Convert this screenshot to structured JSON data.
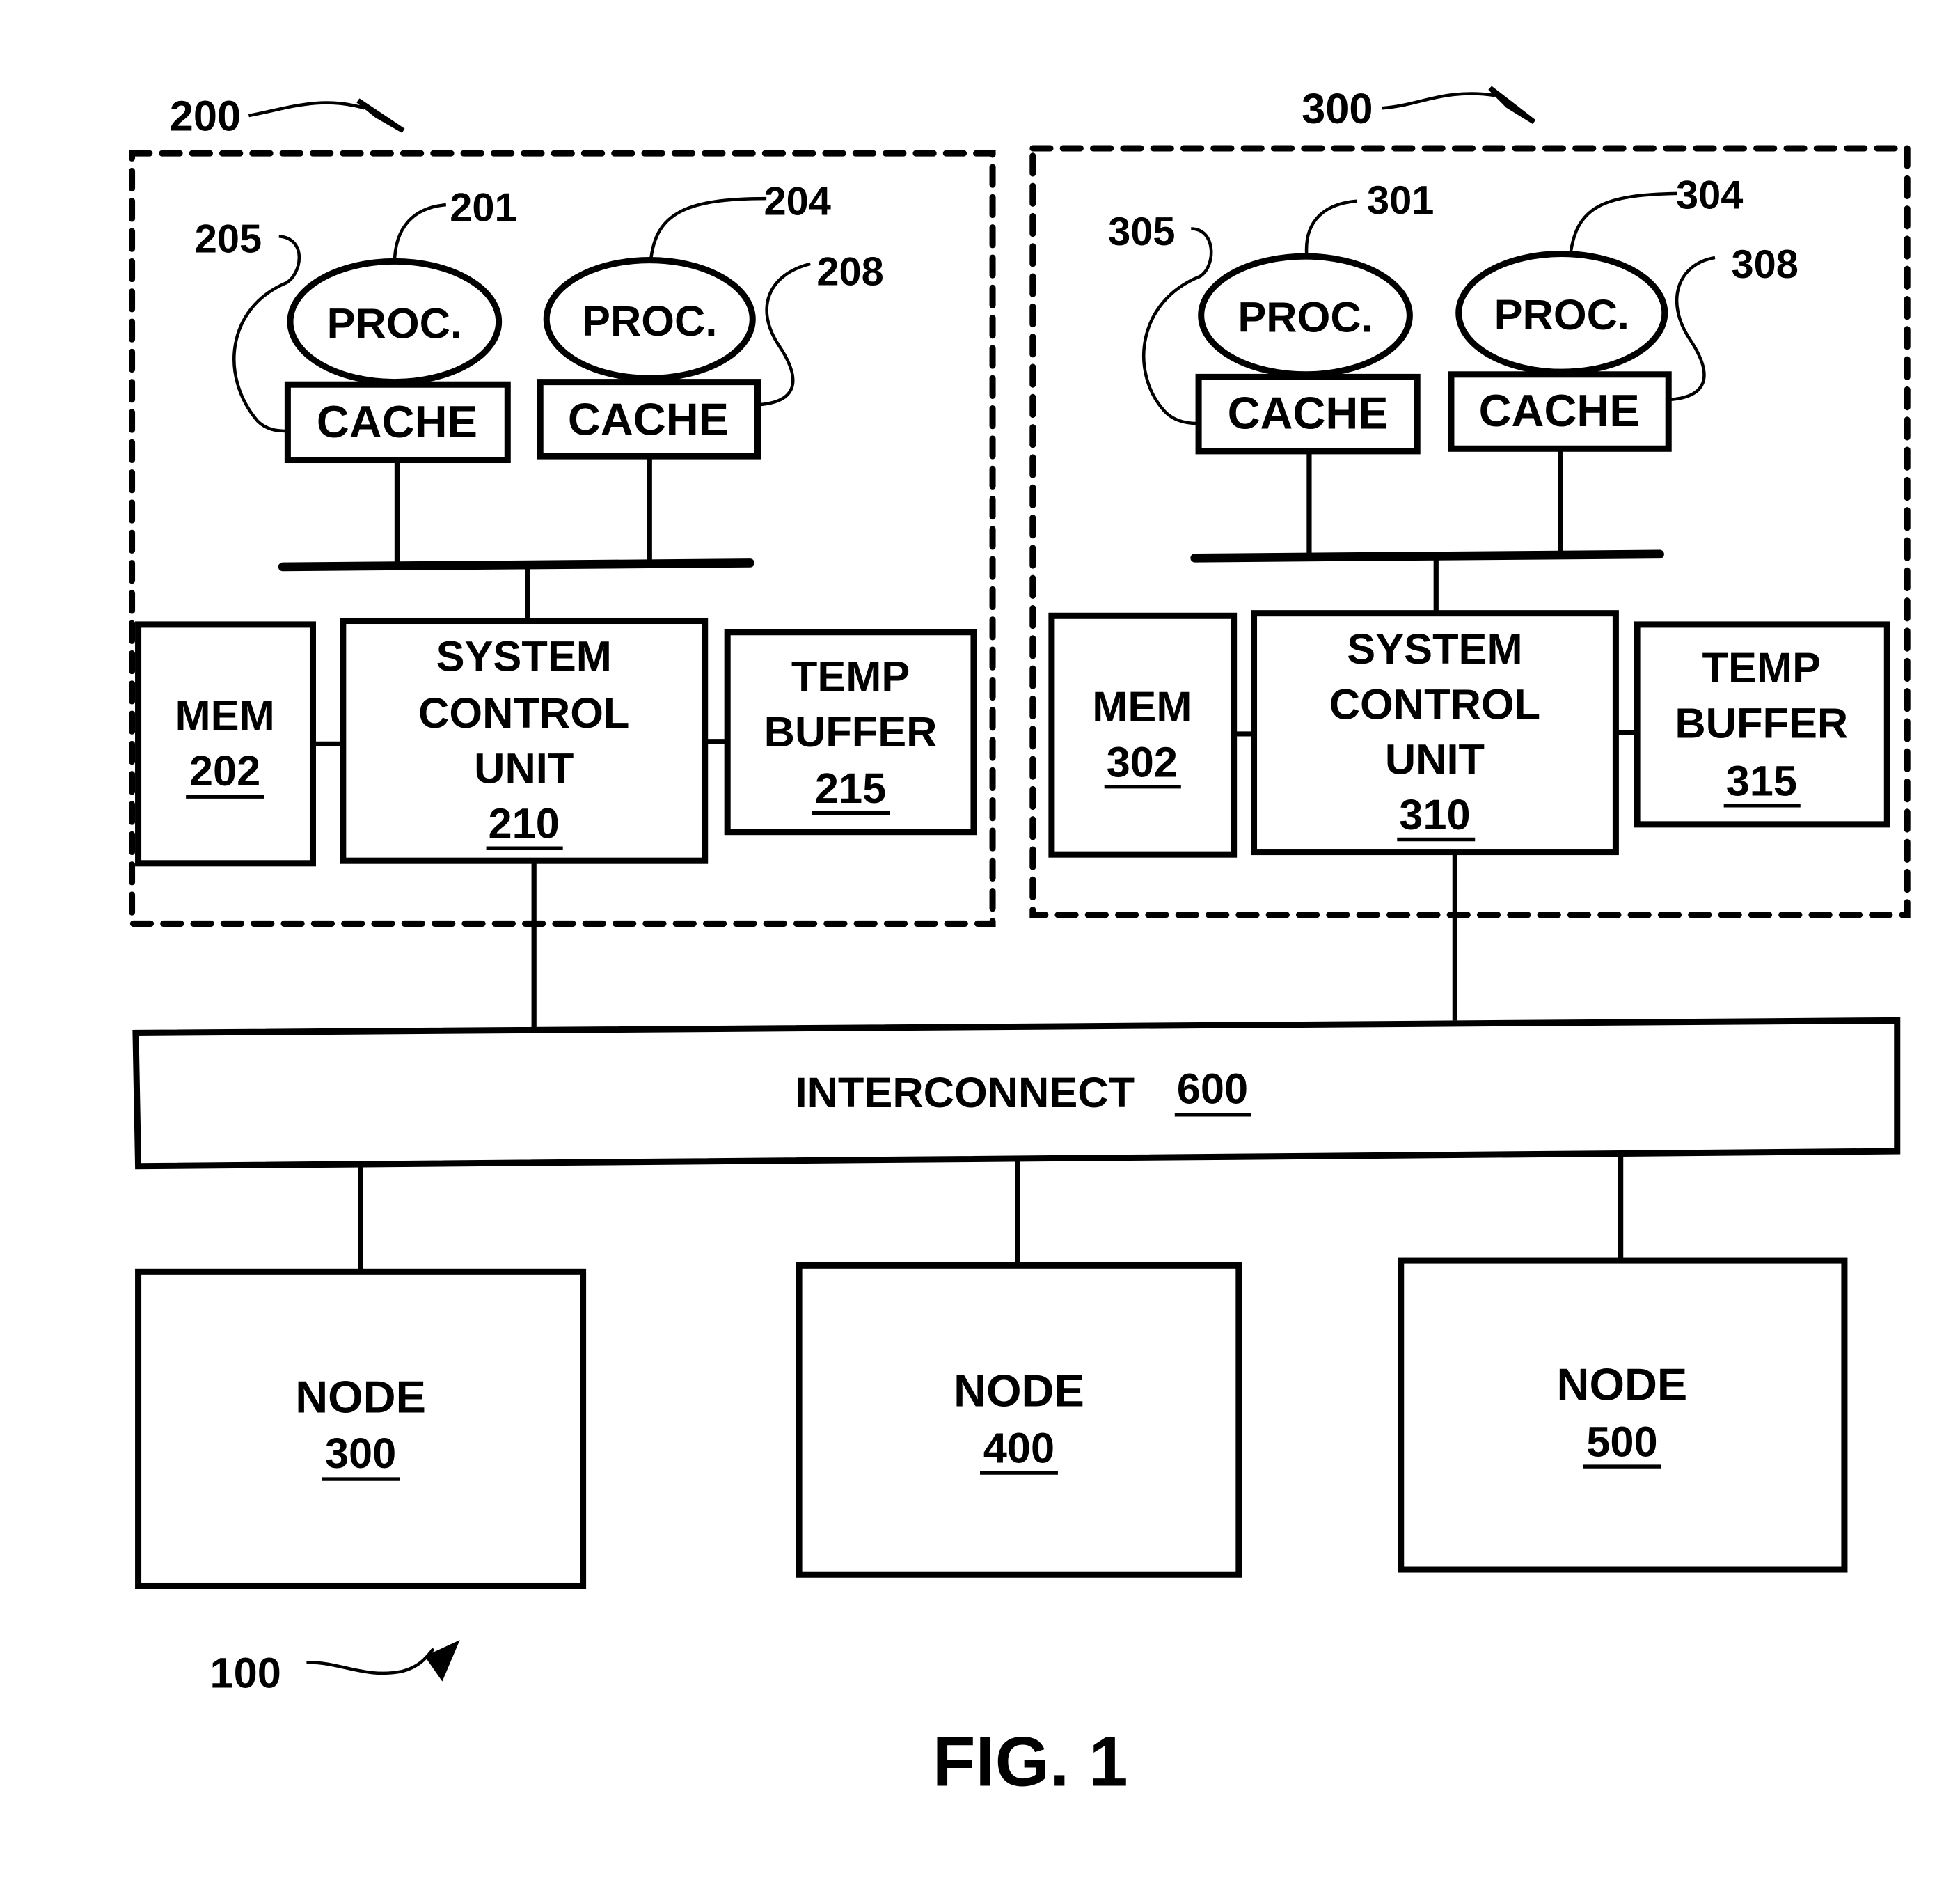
{
  "figure": {
    "caption": "FIG. 1",
    "system_ref": "100"
  },
  "nodes_detailed": [
    {
      "ref": "200",
      "processors": [
        {
          "label": "PROC.",
          "ref": "201",
          "cache_label": "CACHE",
          "cache_ref": "205"
        },
        {
          "label": "PROC.",
          "ref": "204",
          "cache_label": "CACHE",
          "cache_ref": "208"
        }
      ],
      "mem": {
        "label": "MEM",
        "ref": "202"
      },
      "scu": {
        "lines": [
          "SYSTEM",
          "CONTROL",
          "UNIT"
        ],
        "ref": "210"
      },
      "temp_buffer": {
        "lines": [
          "TEMP",
          "BUFFER"
        ],
        "ref": "215"
      }
    },
    {
      "ref": "300",
      "processors": [
        {
          "label": "PROC.",
          "ref": "301",
          "cache_label": "CACHE",
          "cache_ref": "305"
        },
        {
          "label": "PROC.",
          "ref": "304",
          "cache_label": "CACHE",
          "cache_ref": "308"
        }
      ],
      "mem": {
        "label": "MEM",
        "ref": "302"
      },
      "scu": {
        "lines": [
          "SYSTEM",
          "CONTROL",
          "UNIT"
        ],
        "ref": "310"
      },
      "temp_buffer": {
        "lines": [
          "TEMP",
          "BUFFER"
        ],
        "ref": "315"
      }
    }
  ],
  "interconnect": {
    "label": "INTERCONNECT",
    "ref": "600"
  },
  "nodes": [
    {
      "label": "NODE",
      "ref": "300"
    },
    {
      "label": "NODE",
      "ref": "400"
    },
    {
      "label": "NODE",
      "ref": "500"
    }
  ]
}
